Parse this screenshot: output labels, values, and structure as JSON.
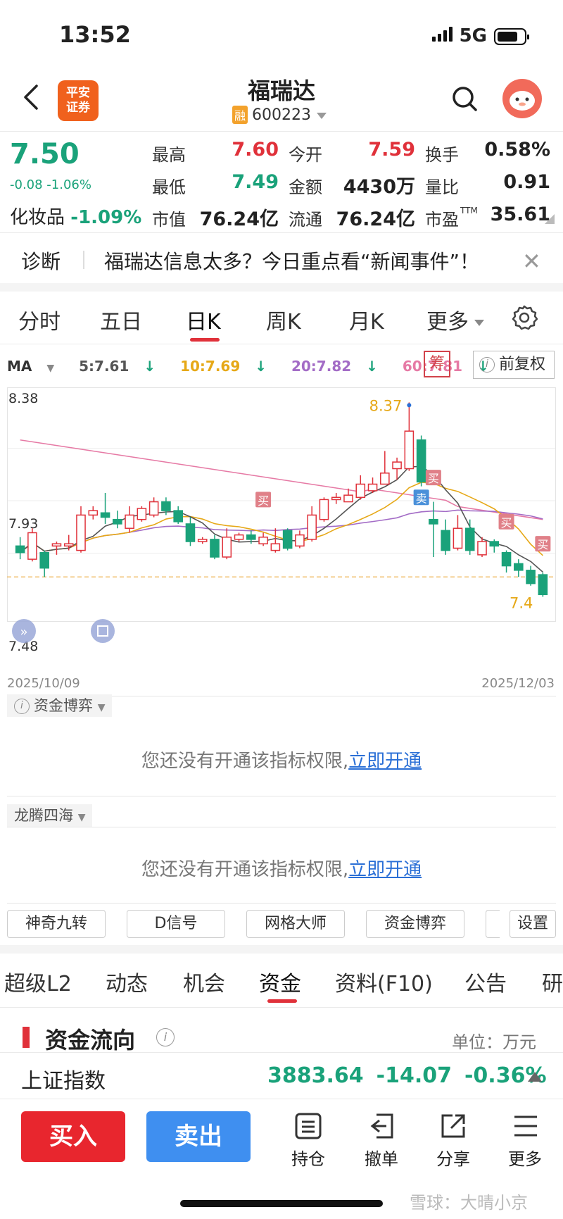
{
  "status": {
    "time": "13:52",
    "network": "5G"
  },
  "header": {
    "title": "福瑞达",
    "code": "600223",
    "rong_badge": "融",
    "logo_line1": "平安",
    "logo_line2": "证券"
  },
  "quote": {
    "price": "7.50",
    "change": "-0.08 -1.06%",
    "sector_name": "化妆品",
    "sector_change": "-1.09%",
    "fields": [
      {
        "label": "最高",
        "value": "7.60",
        "color": "red"
      },
      {
        "label": "今开",
        "value": "7.59",
        "color": "red"
      },
      {
        "label": "换手",
        "value": "0.58%",
        "color": "black"
      },
      {
        "label": "最低",
        "value": "7.49",
        "color": "green"
      },
      {
        "label": "金额",
        "value": "4430万",
        "color": "black"
      },
      {
        "label": "量比",
        "value": "0.91",
        "color": "black"
      },
      {
        "label": "市值",
        "value": "76.24亿",
        "color": "black"
      },
      {
        "label": "流通",
        "value": "76.24亿",
        "color": "black"
      },
      {
        "label": "市盈",
        "value": "35.61",
        "color": "black",
        "sup": "TTM"
      }
    ]
  },
  "diagnose": {
    "title": "诊断",
    "text": "福瑞达信息太多？今日重点看“新闻事件”！"
  },
  "chart_tabs": [
    "分时",
    "五日",
    "日K",
    "周K",
    "月K",
    "更多"
  ],
  "ma": {
    "label": "MA",
    "items": [
      {
        "text": "5:7.61",
        "color": "#555555"
      },
      {
        "text": "10:7.69",
        "color": "#e6a817"
      },
      {
        "text": "20:7.82",
        "color": "#a36cc6"
      },
      {
        "text": "60:7.81",
        "color": "#e67aa5"
      }
    ],
    "arrow": "↓",
    "chou": "筹",
    "fq_label": "前复权"
  },
  "chart_data": {
    "type": "candlestick",
    "ylabels": [
      "8.38",
      "7.93",
      "7.48"
    ],
    "start_date": "2025/10/09",
    "end_date": "2025/12/03",
    "high_mark": "8.37",
    "low_mark": "7.4",
    "ylim": [
      7.45,
      8.4
    ],
    "colors": {
      "up": "#e0313a",
      "down": "#1aa27a",
      "ma5": "#555555",
      "ma10": "#e6a817",
      "ma20": "#a36cc6",
      "ma60": "#e67aa5"
    },
    "candles": [
      [
        7.72,
        7.69,
        7.76,
        7.66
      ],
      [
        7.66,
        7.78,
        7.8,
        7.65
      ],
      [
        7.69,
        7.62,
        7.7,
        7.58
      ],
      [
        7.72,
        7.73,
        7.74,
        7.68
      ],
      [
        7.72,
        7.73,
        7.77,
        7.7
      ],
      [
        7.7,
        7.86,
        7.9,
        7.69
      ],
      [
        7.86,
        7.88,
        7.9,
        7.84
      ],
      [
        7.87,
        7.85,
        7.96,
        7.82
      ],
      [
        7.84,
        7.82,
        7.88,
        7.8
      ],
      [
        7.8,
        7.86,
        7.9,
        7.78
      ],
      [
        7.84,
        7.89,
        7.9,
        7.83
      ],
      [
        7.86,
        7.92,
        7.94,
        7.85
      ],
      [
        7.92,
        7.88,
        7.94,
        7.86
      ],
      [
        7.88,
        7.83,
        7.9,
        7.82
      ],
      [
        7.82,
        7.74,
        7.85,
        7.72
      ],
      [
        7.74,
        7.75,
        7.76,
        7.73
      ],
      [
        7.75,
        7.67,
        7.77,
        7.66
      ],
      [
        7.67,
        7.76,
        7.8,
        7.66
      ],
      [
        7.75,
        7.77,
        7.78,
        7.74
      ],
      [
        7.77,
        7.75,
        7.79,
        7.73
      ],
      [
        7.73,
        7.76,
        7.78,
        7.72
      ],
      [
        7.7,
        7.73,
        7.8,
        7.69
      ],
      [
        7.79,
        7.71,
        7.8,
        7.7
      ],
      [
        7.72,
        7.77,
        7.79,
        7.71
      ],
      [
        7.75,
        7.86,
        7.9,
        7.74
      ],
      [
        7.84,
        7.93,
        7.94,
        7.83
      ],
      [
        7.93,
        7.94,
        7.96,
        7.91
      ],
      [
        7.92,
        7.95,
        7.98,
        7.92
      ],
      [
        7.94,
        8.0,
        8.04,
        7.93
      ],
      [
        7.97,
        8.0,
        8.03,
        7.96
      ],
      [
        8.0,
        8.05,
        8.15,
        8.0
      ],
      [
        8.07,
        8.1,
        8.12,
        8.02
      ],
      [
        8.07,
        8.24,
        8.37,
        8.06
      ],
      [
        8.2,
        8.01,
        8.22,
        7.99
      ],
      [
        7.84,
        7.82,
        7.92,
        7.67
      ],
      [
        7.79,
        7.7,
        7.84,
        7.68
      ],
      [
        7.71,
        7.8,
        7.86,
        7.7
      ],
      [
        7.8,
        7.7,
        7.84,
        7.68
      ],
      [
        7.68,
        7.74,
        7.76,
        7.67
      ],
      [
        7.74,
        7.72,
        7.75,
        7.69
      ],
      [
        7.69,
        7.63,
        7.7,
        7.6
      ],
      [
        7.64,
        7.61,
        7.66,
        7.58
      ],
      [
        7.61,
        7.55,
        7.63,
        7.54
      ],
      [
        7.59,
        7.5,
        7.6,
        7.49
      ]
    ],
    "markers": [
      {
        "text": "买",
        "index": 20,
        "price": 7.93
      },
      {
        "text": "卖",
        "index": 33,
        "price": 7.94
      },
      {
        "text": "买",
        "index": 34,
        "price": 8.03
      },
      {
        "text": "买",
        "index": 40,
        "price": 7.83
      },
      {
        "text": "买",
        "index": 43,
        "price": 7.73
      }
    ]
  },
  "indicator1": {
    "tab": "资金博弈",
    "message": "您还没有开通该指标权限,",
    "link": "立即开通"
  },
  "indicator2": {
    "tab": "龙腾四海",
    "message": "您还没有开通该指标权限,",
    "link": "立即开通"
  },
  "indicator_buttons": [
    "神奇九转",
    "D信号",
    "网格大师",
    "资金博弈",
    "设置"
  ],
  "section_tabs": [
    "超级L2",
    "动态",
    "机会",
    "资金",
    "资料(F10)",
    "公告",
    "研"
  ],
  "fund_flow": {
    "title": "资金流向",
    "unit": "单位：万元"
  },
  "index": {
    "name": "上证指数",
    "value": "3883.64",
    "change": "-14.07",
    "pct": "-0.36%"
  },
  "bottom": {
    "buy": "买入",
    "sell": "卖出",
    "hold": "持仓",
    "cancel": "撤单",
    "share": "分享",
    "more": "更多"
  },
  "watermark": "雪球：大晴小京"
}
